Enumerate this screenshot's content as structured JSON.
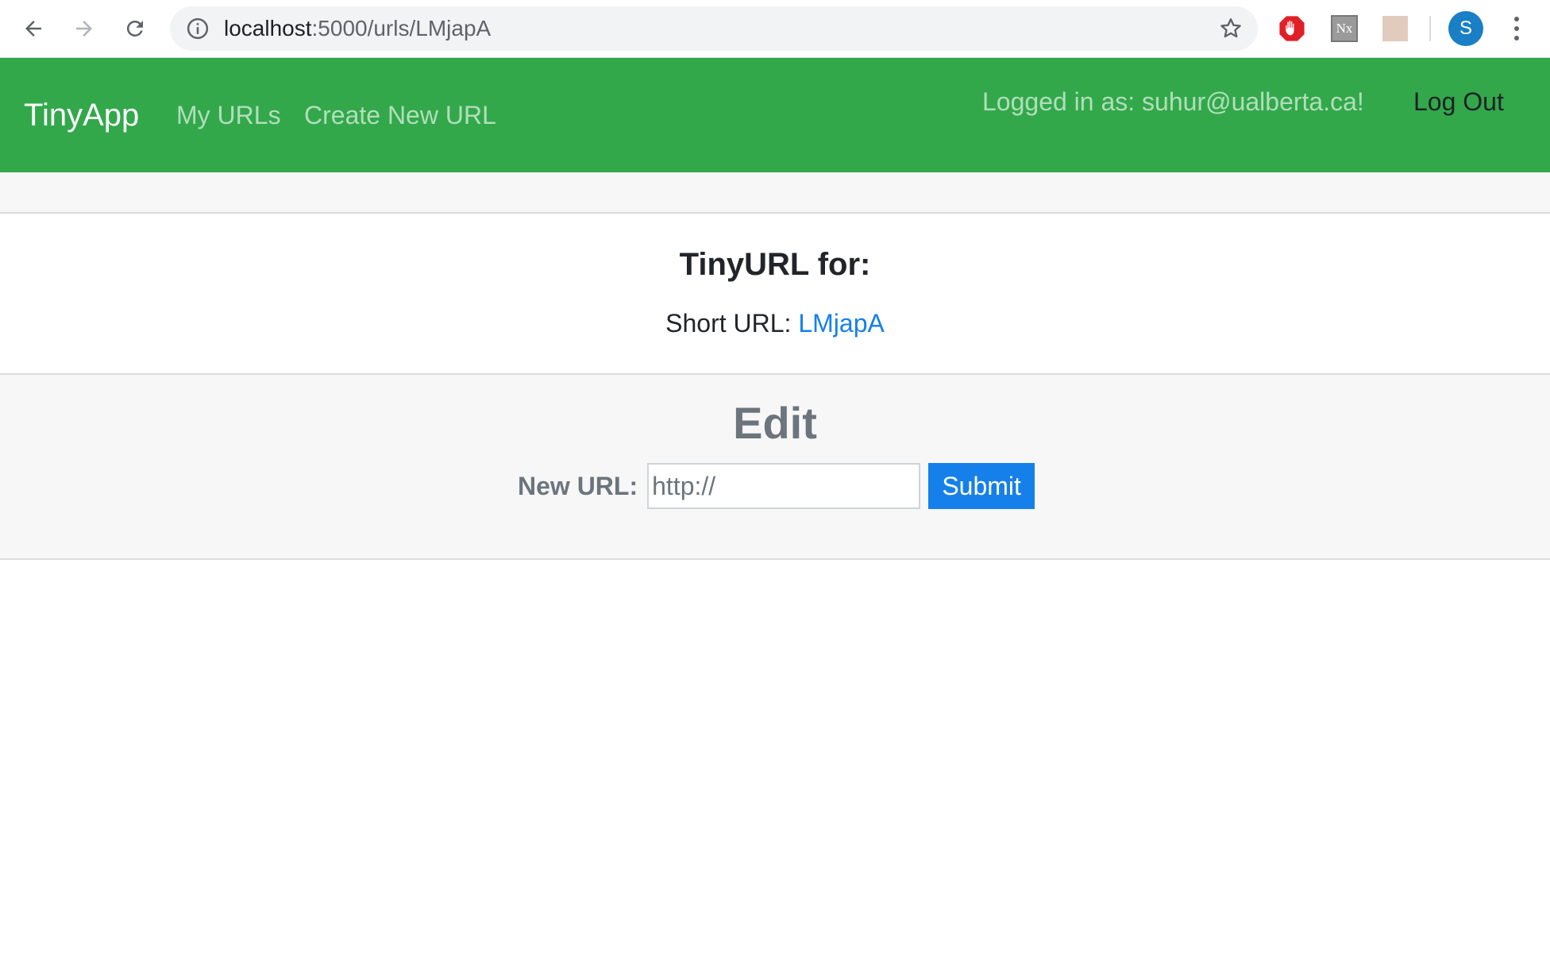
{
  "browser": {
    "url_host": "localhost",
    "url_path": ":5000/urls/LMjapA",
    "extensions": [
      "adblock-icon",
      "nx-extension-icon",
      "tan-extension-icon"
    ],
    "nx_label": "Nx",
    "profile_initial": "S"
  },
  "navbar": {
    "brand": "TinyApp",
    "links": [
      "My URLs",
      "Create New URL"
    ],
    "logged_in_text": "Logged in as: suhur@ualberta.ca!",
    "logout": "Log Out",
    "color": "#32a84b"
  },
  "card": {
    "title": "TinyURL for:",
    "short_url_label": "Short URL: ",
    "short_url_value": "LMjapA"
  },
  "edit": {
    "title": "Edit",
    "label": "New URL:",
    "placeholder": "http://",
    "submit": "Submit",
    "button_color": "#1580ea"
  }
}
